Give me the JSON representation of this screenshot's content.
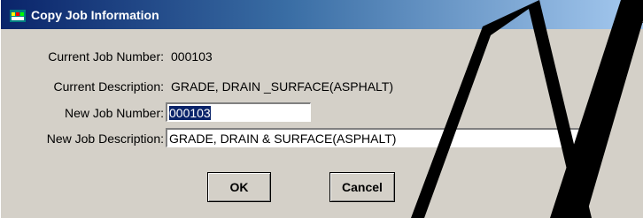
{
  "window": {
    "title": "Copy Job Information",
    "close_label": "✕"
  },
  "fields": {
    "current_job_number_label": "Current Job Number:",
    "current_job_number_value": "000103",
    "current_description_label": "Current Description:",
    "current_description_value": "GRADE, DRAIN _SURFACE(ASPHALT)",
    "new_job_number_label": "New Job Number:",
    "new_job_number_value": "000103",
    "new_job_description_label": "New Job Description:",
    "new_job_description_value": "GRADE, DRAIN & SURFACE(ASPHALT)"
  },
  "buttons": {
    "ok_label": "OK",
    "cancel_label": "Cancel"
  },
  "colors": {
    "titlebar_start": "#0a246a",
    "titlebar_end": "#a6caf0",
    "dialog_background": "#d4d0c8",
    "selection": "#0a246a",
    "watermark": "#000000"
  },
  "icons": {
    "title_icon": "app-window-icon",
    "close_icon": "close-icon"
  }
}
